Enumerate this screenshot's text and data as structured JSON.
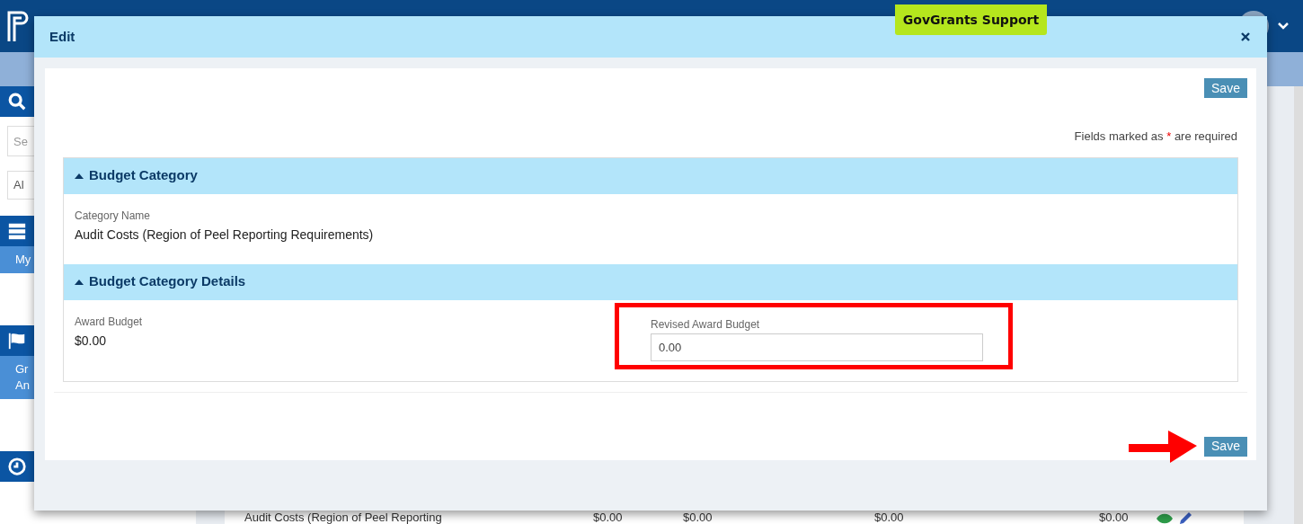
{
  "support_badge": "GovGrants Support",
  "sidebar": {
    "search_placeholder": "Se",
    "filter_value": "Al",
    "menu_items": [
      {
        "label": "My",
        "selected": true
      },
      {
        "label": "Gr An",
        "selected": true
      }
    ]
  },
  "background_row": {
    "name": "Audit Costs (Region of Peel Reporting",
    "values": [
      "$0.00",
      "$0.00",
      "$0.00",
      "$0.00"
    ]
  },
  "modal": {
    "title": "Edit",
    "top_save": "Save",
    "required_note": {
      "before": "Fields marked as",
      "mark": "*",
      "after": "are required"
    },
    "sections": [
      {
        "title": "Budget Category",
        "expanded": true,
        "fields": [
          {
            "kind": "display",
            "label": "Category Name",
            "value": "Audit Costs (Region of Peel Reporting Requirements)"
          }
        ]
      },
      {
        "title": "Budget Category Details",
        "expanded": true,
        "fields": [
          {
            "kind": "display",
            "label": "Award Budget",
            "value": "$0.00"
          },
          {
            "kind": "input",
            "label": "Revised Award Budget",
            "value": "0.00",
            "highlighted": true
          }
        ]
      }
    ],
    "bottom_save": "Save",
    "arrow_annotation": true
  }
}
